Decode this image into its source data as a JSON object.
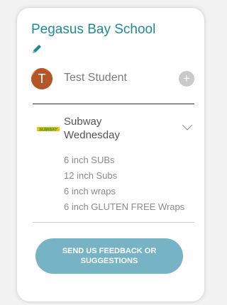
{
  "header": {
    "school_name": "Pegasus Bay School",
    "edit_icon": "pencil-icon"
  },
  "student": {
    "initial": "T",
    "name": "Test Student",
    "add_icon": "plus-icon",
    "avatar_color": "#e57b37"
  },
  "vendor": {
    "logo_text": "SUBWAY",
    "name": "Subway",
    "day": "Wednesday",
    "expand_icon": "chevron-down-icon"
  },
  "menu_items": [
    "6 inch SUBs",
    "12 inch Subs",
    "6 inch wraps",
    "6 inch GLUTEN FREE Wraps"
  ],
  "feedback_button": {
    "label": "SEND US FEEDBACK OR SUGGESTIONS",
    "color": "#76b3c4"
  },
  "colors": {
    "accent": "#1f8a96",
    "logo_yellow": "#f5c400",
    "logo_green": "#1a8a3a"
  }
}
